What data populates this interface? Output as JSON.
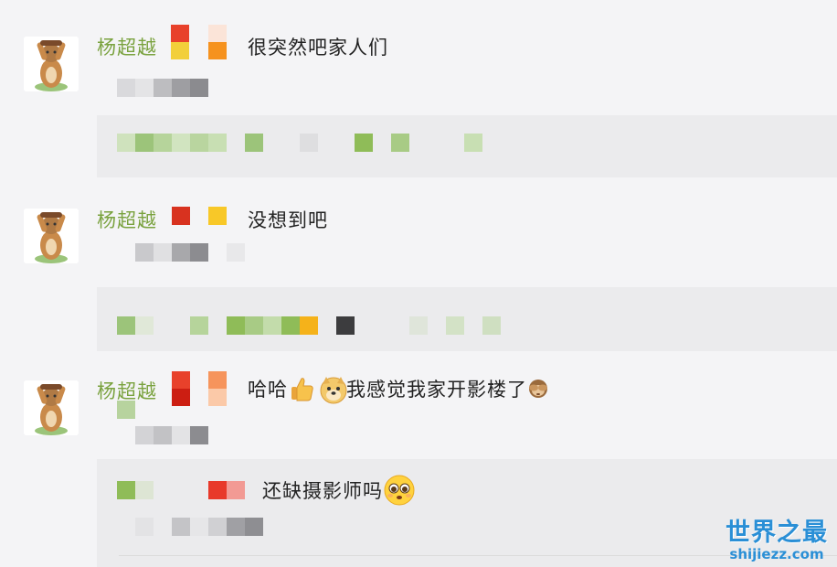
{
  "comments": [
    {
      "username": "杨超越",
      "text": "很突然吧家人们"
    },
    {
      "username": "杨超越",
      "text": "没想到吧"
    },
    {
      "username": "杨超越",
      "text_before": "哈哈",
      "text_after": "我感觉我家开影楼了",
      "emojis": [
        "thumbs-up-icon",
        "doge-icon",
        "see-no-evil-monkey-icon"
      ]
    }
  ],
  "reply": {
    "text": "还缺摄影师吗",
    "emoji": "pleading-face-icon"
  },
  "watermark": {
    "main": "世界之最",
    "sub": "shijiezz.com"
  },
  "colors": {
    "username": "#7aa23f",
    "background": "#f4f4f6",
    "reply_box": "#ebebed",
    "watermark": "#2a8fd6"
  }
}
